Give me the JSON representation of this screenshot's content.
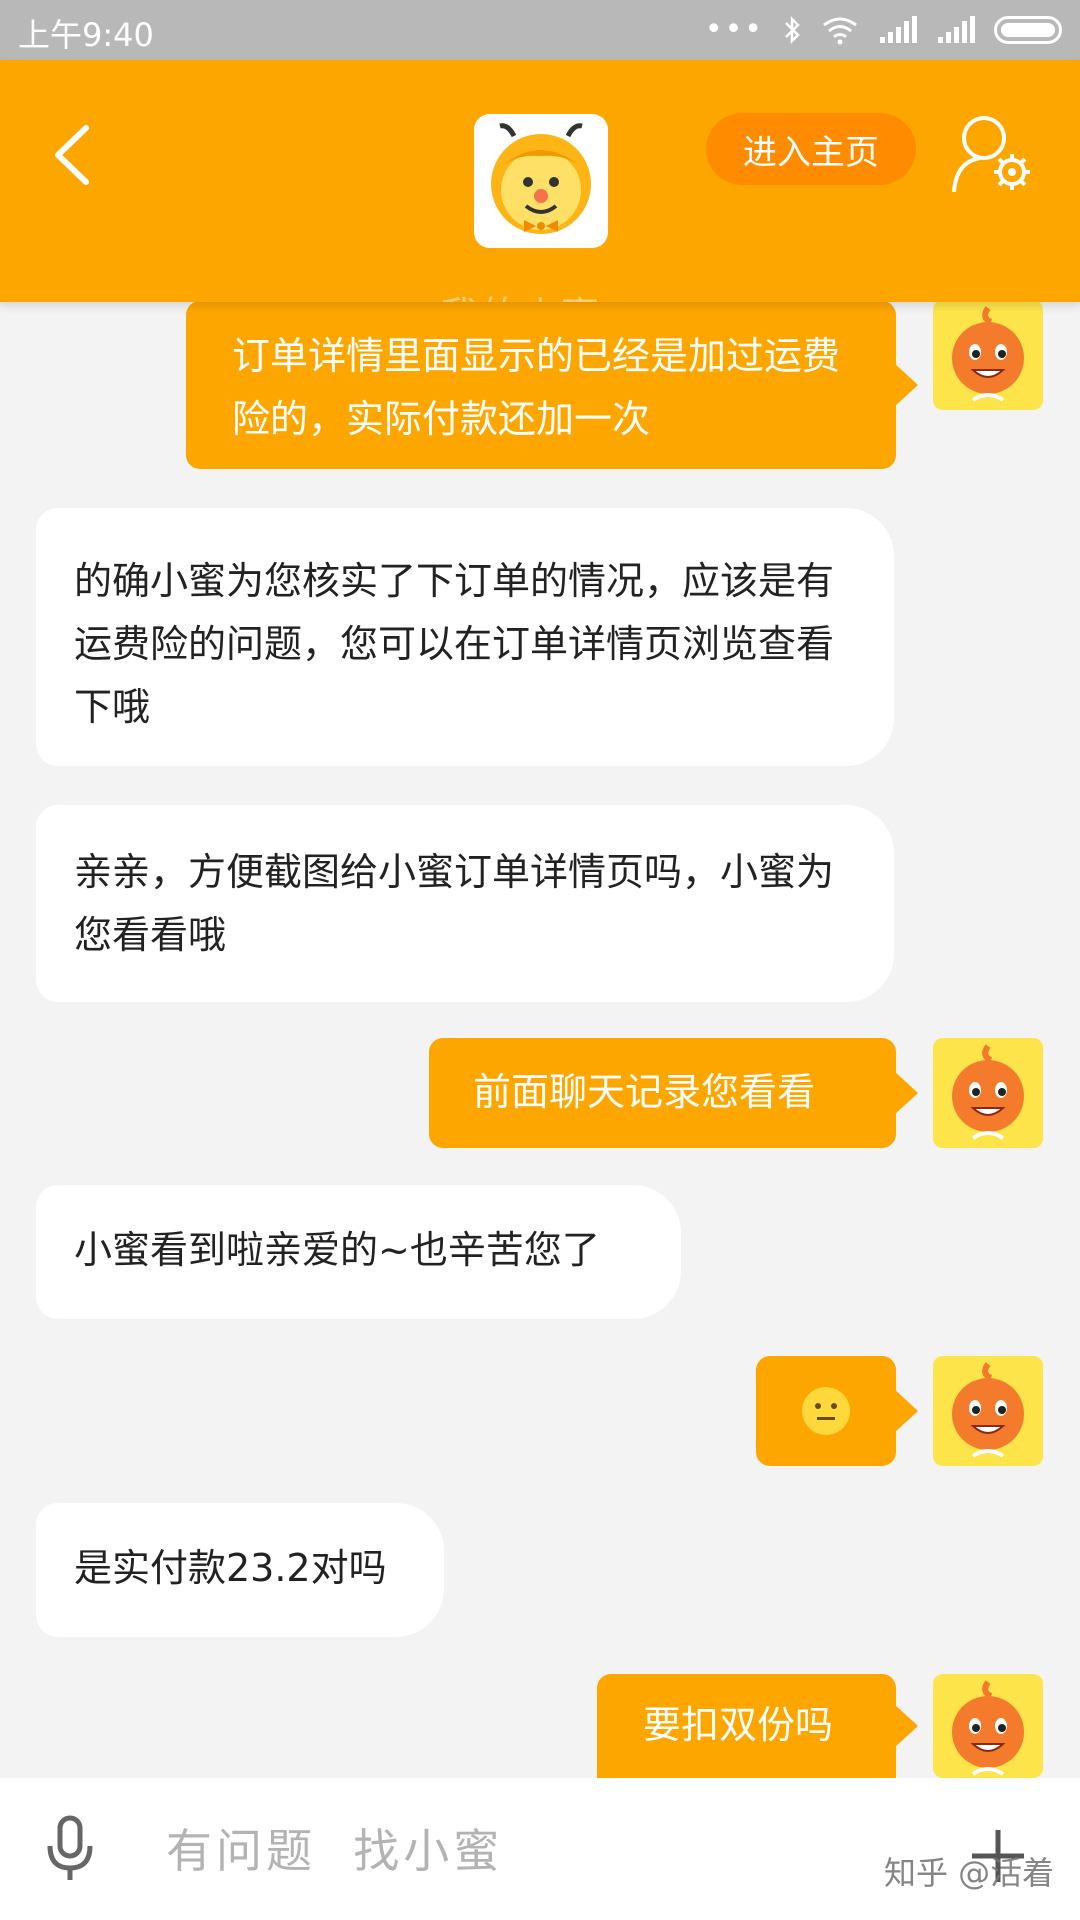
{
  "status_bar": {
    "time": "上午9:40",
    "dots": "•••"
  },
  "header": {
    "homepage_label": "进入主页",
    "ghost_title": "我的小蜜"
  },
  "messages": [
    {
      "side": "right",
      "text": "订单详情里面显示的已经是加过运费险的，实际付款还加一次"
    },
    {
      "side": "left",
      "text": "的确小蜜为您核实了下订单的情况，应该是有运费险的问题，您可以在订单详情页浏览查看下哦"
    },
    {
      "side": "left",
      "text": "亲亲，方便截图给小蜜订单详情页吗，小蜜为您看看哦"
    },
    {
      "side": "right",
      "text": "前面聊天记录您看看"
    },
    {
      "side": "left",
      "text": "小蜜看到啦亲爱的~也辛苦您了"
    },
    {
      "side": "right",
      "text": "",
      "emoji": "neutral-face"
    },
    {
      "side": "left",
      "text": "是实付款23.2对吗"
    },
    {
      "side": "right",
      "text": "要扣双份吗"
    }
  ],
  "input": {
    "placeholder": "有问题  找小蜜"
  },
  "watermark": "知乎 @活着",
  "colors": {
    "accent": "#fea600",
    "button": "#ff8c00",
    "background": "#f2f3f2",
    "avatar_bg": "#fde44a"
  },
  "icons": [
    "back-arrow-icon",
    "bee-mascot-icon",
    "profile-settings-icon",
    "microphone-icon",
    "plus-icon",
    "user-avatar-icon"
  ]
}
